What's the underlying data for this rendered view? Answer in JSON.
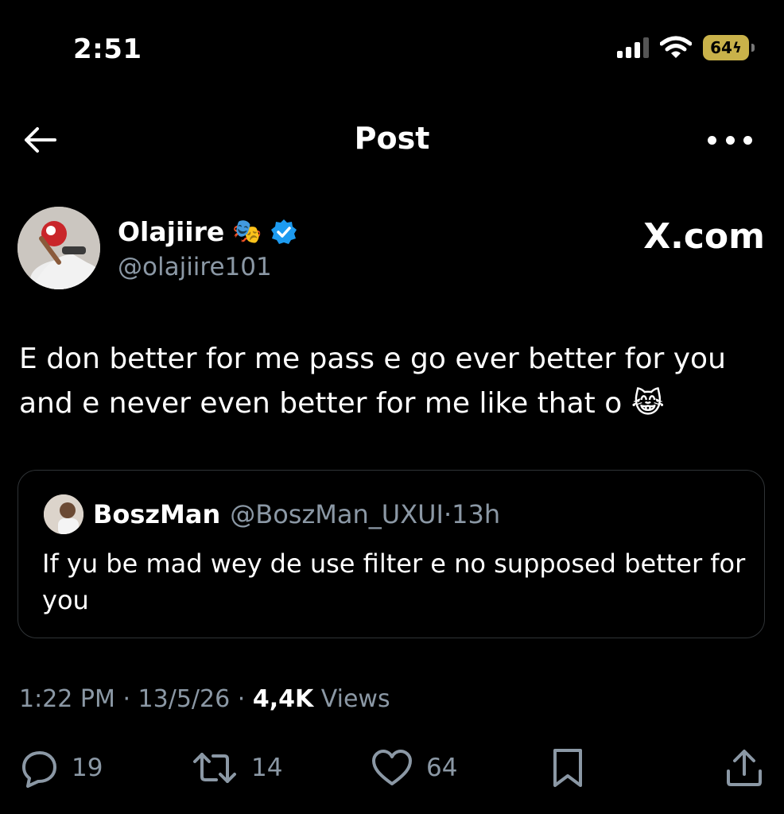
{
  "status_bar": {
    "time": "2:51",
    "battery": "64"
  },
  "nav": {
    "title": "Post"
  },
  "author": {
    "name": "Olajiire",
    "emoji": "🎭",
    "handle": "@olajiire101",
    "watermark": "X.com"
  },
  "post": {
    "text": "E don better for me pass e go ever better for you and e never even better for me like that o 😹"
  },
  "quoted_post": {
    "name": "BoszMan",
    "handle": "@BoszMan_UXUI",
    "time": "13h",
    "text": "If yu be mad wey de use filter e no supposed better for you"
  },
  "meta": {
    "time": "1:22 PM",
    "date": "13/5/26",
    "views_count": "4,4K",
    "views_label": "Views"
  },
  "actions": {
    "replies": "19",
    "reposts": "14",
    "likes": "64"
  },
  "colors": {
    "background": "#000000",
    "text": "#e7e9ea",
    "secondary": "#8b98a5",
    "verified": "#1d9bf0",
    "border": "#2f3336"
  }
}
